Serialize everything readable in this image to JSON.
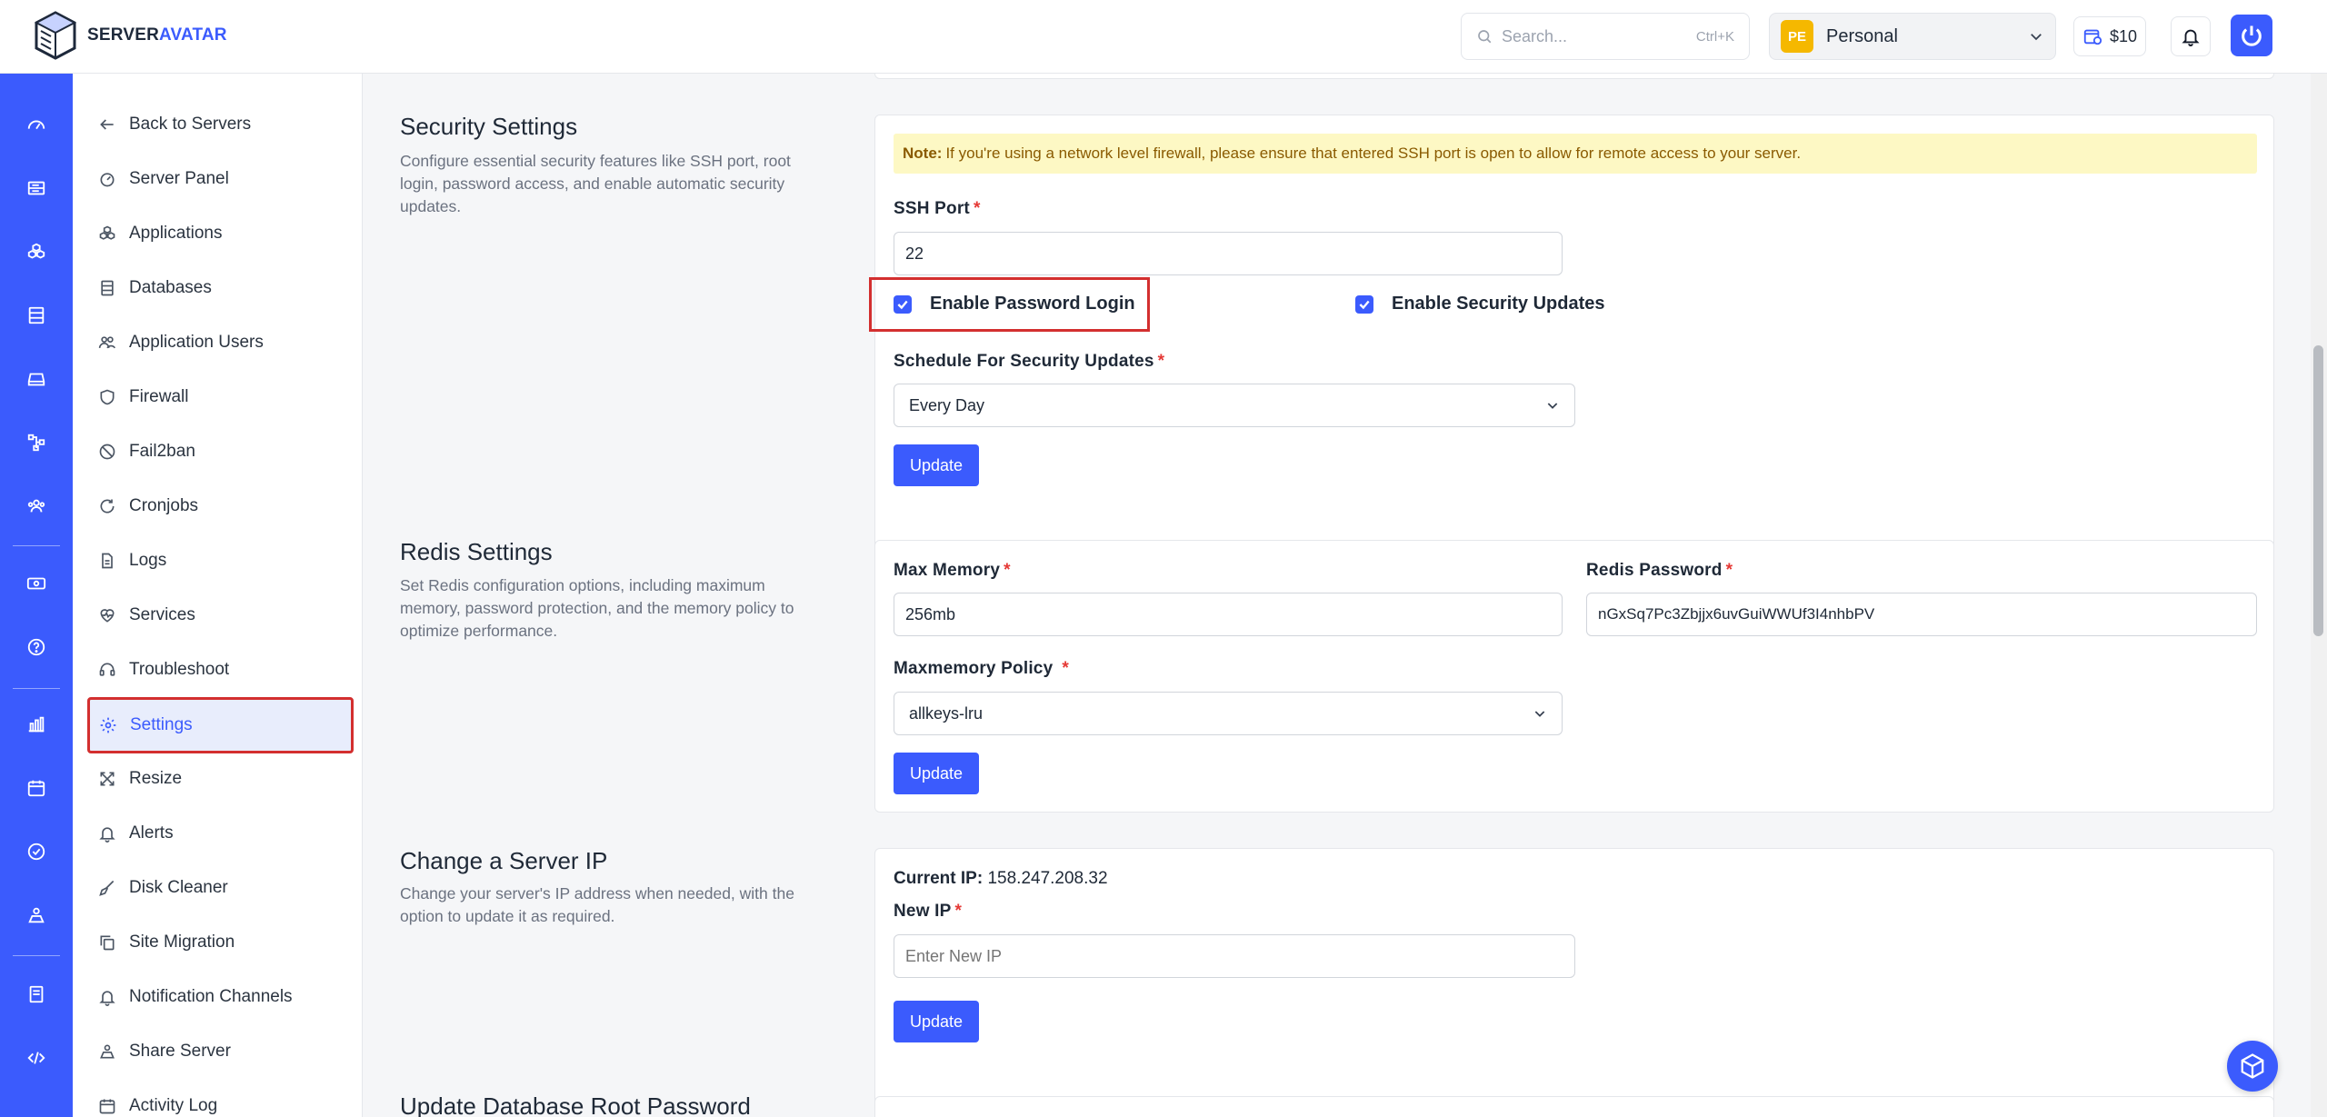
{
  "brand": {
    "name_part1": "SERVER",
    "name_part2": "AVATAR"
  },
  "search": {
    "placeholder": "Search...",
    "shortcut": "Ctrl+K"
  },
  "workspace": {
    "badge": "PE",
    "name": "Personal"
  },
  "credit": {
    "amount": "$10"
  },
  "rail": {
    "icons": [
      "dashboard-icon",
      "servers-icon",
      "applications-icon",
      "databases-icon",
      "storage-icon",
      "network-icon",
      "team-icon",
      "billing-icon",
      "help-icon",
      "analytics-icon",
      "calendar-icon",
      "check-icon",
      "integrations-icon",
      "docs-icon",
      "api-icon"
    ]
  },
  "sidebar": {
    "items": [
      {
        "label": "Back to Servers",
        "icon": "arrow-left-icon"
      },
      {
        "label": "Server Panel",
        "icon": "gauge-icon"
      },
      {
        "label": "Applications",
        "icon": "cubes-icon"
      },
      {
        "label": "Databases",
        "icon": "database-icon"
      },
      {
        "label": "Application Users",
        "icon": "users-icon"
      },
      {
        "label": "Firewall",
        "icon": "shield-icon"
      },
      {
        "label": "Fail2ban",
        "icon": "ban-icon"
      },
      {
        "label": "Cronjobs",
        "icon": "refresh-icon"
      },
      {
        "label": "Logs",
        "icon": "file-icon"
      },
      {
        "label": "Services",
        "icon": "heartbeat-icon"
      },
      {
        "label": "Troubleshoot",
        "icon": "headset-icon"
      },
      {
        "label": "Settings",
        "icon": "gear-icon"
      },
      {
        "label": "Resize",
        "icon": "expand-icon"
      },
      {
        "label": "Alerts",
        "icon": "bell-icon"
      },
      {
        "label": "Disk Cleaner",
        "icon": "broom-icon"
      },
      {
        "label": "Site Migration",
        "icon": "copy-icon"
      },
      {
        "label": "Notification Channels",
        "icon": "bell-icon"
      },
      {
        "label": "Share Server",
        "icon": "share-icon"
      },
      {
        "label": "Activity Log",
        "icon": "calendar-icon"
      }
    ],
    "active": "Settings"
  },
  "security": {
    "title": "Security Settings",
    "description": "Configure essential security features like SSH port, root login, password access, and enable automatic security updates.",
    "note_label": "Note:",
    "note_text": "If you're using a network level firewall, please ensure that entered SSH port is open to allow for remote access to your server.",
    "ssh_port_label": "SSH Port",
    "ssh_port_value": "22",
    "password_login_label": "Enable Password Login",
    "password_login_checked": true,
    "security_updates_label": "Enable Security Updates",
    "security_updates_checked": true,
    "schedule_label": "Schedule For Security Updates",
    "schedule_value": "Every Day",
    "update_label": "Update"
  },
  "redis": {
    "title": "Redis Settings",
    "description": "Set Redis configuration options, including maximum memory, password protection, and the memory policy to optimize performance.",
    "max_memory_label": "Max Memory",
    "max_memory_value": "256mb",
    "password_label": "Redis Password",
    "password_value": "nGxSq7Pc3Zbjjx6uvGuiWWUf3I4nhbPV",
    "policy_label": "Maxmemory Policy",
    "policy_value": "allkeys-lru",
    "update_label": "Update"
  },
  "change_ip": {
    "title": "Change a Server IP",
    "description": "Change your server's IP address when needed, with the option to update it as required.",
    "current_ip_label": "Current IP:",
    "current_ip_value": "158.247.208.32",
    "new_ip_label": "New IP",
    "new_ip_placeholder": "Enter New IP",
    "update_label": "Update"
  },
  "db_root": {
    "title": "Update Database Root Password"
  },
  "colors": {
    "primary": "#3b5bfd",
    "highlight": "#d32f2f",
    "note_bg": "#fdf8c4"
  }
}
